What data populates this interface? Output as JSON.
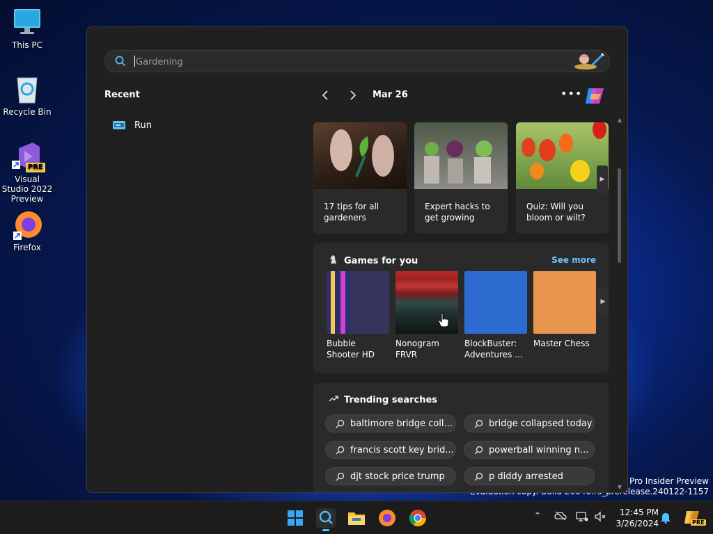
{
  "desktop": {
    "icons": [
      {
        "label": "This PC"
      },
      {
        "label": "Recycle Bin"
      },
      {
        "label": "Visual Studio 2022 Preview",
        "badge": "PRE"
      },
      {
        "label": "Firefox"
      }
    ],
    "watermark_line1": "s 11 Pro Insider Preview",
    "watermark_line2": "Evaluation copy. Build 26040.rs_prerelease.240122-1157"
  },
  "search_panel": {
    "search_placeholder": "Gardening",
    "recent_title": "Recent",
    "recent_items": [
      {
        "label": "Run",
        "icon": "run-icon"
      }
    ],
    "date": "Mar 26",
    "news": [
      {
        "caption": "17 tips for all gardeners"
      },
      {
        "caption": "Expert hacks to get growing"
      },
      {
        "caption": "Quiz: Will you bloom or wilt?"
      }
    ],
    "games": {
      "title": "Games for you",
      "see_more": "See more",
      "items": [
        {
          "name": "Bubble Shooter HD"
        },
        {
          "name": "Nonogram FRVR"
        },
        {
          "name": "BlockBuster: Adventures ..."
        },
        {
          "name": "Master Chess"
        }
      ]
    },
    "trending": {
      "title": "Trending searches",
      "chips": [
        "baltimore bridge coll...",
        "bridge collapsed today",
        "francis scott key brid...",
        "powerball winning n...",
        "djt stock price trump",
        "p diddy arrested"
      ]
    }
  },
  "taskbar": {
    "time": "12:45 PM",
    "date": "3/26/2024",
    "apps": [
      "windows-start",
      "search",
      "file-explorer",
      "firefox",
      "chrome"
    ],
    "copilot_badge": "PRE"
  },
  "colors": {
    "accent_link": "#6fc2ff",
    "panel_bg": "#202020",
    "card_bg": "#2a2a2a"
  }
}
